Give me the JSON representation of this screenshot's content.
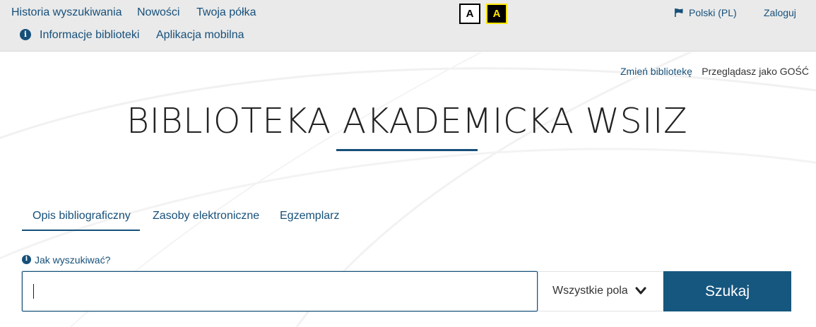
{
  "topnav": {
    "history": "Historia wyszukiwania",
    "news": "Nowości",
    "shelf": "Twoja półka",
    "library_info": "Informacje biblioteki",
    "mobile_app": "Aplikacja mobilna"
  },
  "contrast": {
    "normal_label": "A",
    "high_label": "A"
  },
  "language": "Polski (PL)",
  "login": "Zaloguj",
  "change_library": "Zmień bibliotekę",
  "browsing_as": "Przeglądasz jako GOŚĆ",
  "title": "BIBLIOTEKA AKADEMICKA WSIIZ",
  "tabs": [
    {
      "label": "Opis bibliograficzny",
      "active": true
    },
    {
      "label": "Zasoby elektroniczne",
      "active": false
    },
    {
      "label": "Egzemplarz",
      "active": false
    }
  ],
  "search": {
    "how_to": "Jak wyszukiwać?",
    "value": "",
    "field_select": "Wszystkie pola",
    "submit_label": "Szukaj"
  },
  "colors": {
    "accent": "#16507a",
    "topbar_bg": "#eaeaea",
    "button_bg": "#16577f",
    "high_contrast_fg": "#ffe600"
  },
  "icons": [
    "info-icon",
    "flag-icon",
    "chevron-down-icon"
  ]
}
